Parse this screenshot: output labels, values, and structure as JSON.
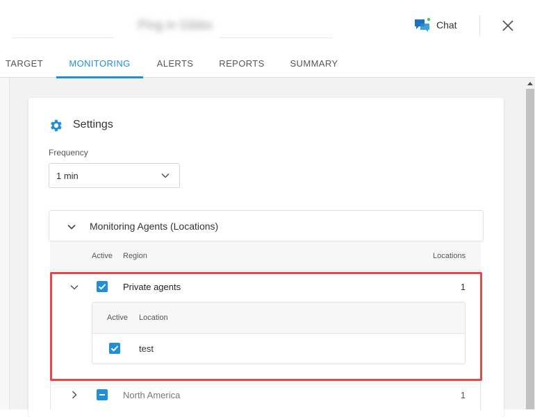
{
  "header": {
    "title": "Ping in Gibbs",
    "chat_label": "Chat"
  },
  "tabs": [
    {
      "label": "TARGET"
    },
    {
      "label": "MONITORING"
    },
    {
      "label": "ALERTS"
    },
    {
      "label": "REPORTS"
    },
    {
      "label": "SUMMARY"
    }
  ],
  "active_tab": "MONITORING",
  "settings": {
    "title": "Settings",
    "frequency_label": "Frequency",
    "frequency_value": "1 min"
  },
  "agents": {
    "title": "Monitoring Agents (Locations)",
    "col_active": "Active",
    "col_region": "Region",
    "col_locations": "Locations",
    "regions": [
      {
        "name": "Private agents",
        "count": "1",
        "expanded": true,
        "checked": "checked",
        "nested": {
          "col_active": "Active",
          "col_location": "Location",
          "locations": [
            {
              "name": "test",
              "checked": "checked"
            }
          ]
        }
      },
      {
        "name": "North America",
        "count": "1",
        "expanded": false,
        "checked": "partial"
      }
    ]
  },
  "colors": {
    "accent": "#1e8fd8",
    "highlight": "#e8474a",
    "chat_icon_green": "#3cc46a"
  },
  "icons": {
    "chat": "chat-bubbles-icon",
    "close": "close-icon",
    "settings": "gear-icon"
  }
}
